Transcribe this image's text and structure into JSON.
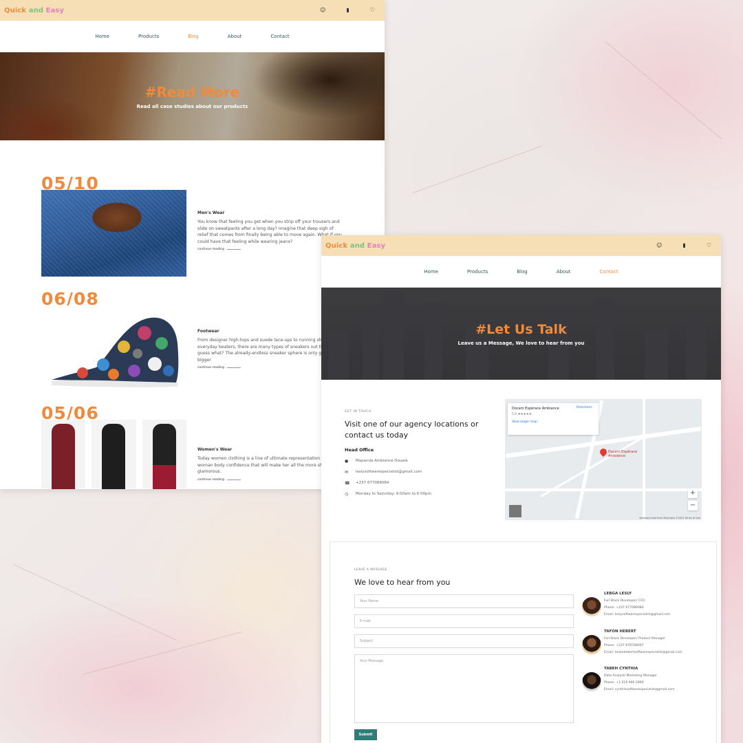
{
  "colors": {
    "accent_orange": "#f08a3c",
    "nav_teal": "#2f5a55",
    "topbar_cream": "#f6dfb4",
    "submit_green": "#2e7d78"
  },
  "blog_page": {
    "logo": {
      "part1": "Quick",
      "part2": " and ",
      "part3": "Easy"
    },
    "top_icons": [
      "user-icon",
      "bag-icon",
      "heart-icon"
    ],
    "nav": [
      {
        "label": "Home"
      },
      {
        "label": "Products"
      },
      {
        "label": "Blog"
      },
      {
        "label": "About"
      },
      {
        "label": "Contact"
      }
    ],
    "active_nav": "Blog",
    "hero": {
      "title": "#Read More",
      "subtitle": "Read all case studies about our products"
    },
    "posts": [
      {
        "date": "05/10",
        "category": "Men's Wear",
        "body": "You know that feeling you get when you strip off your trousers and slide on sweatpants after a long day? Imagine that deep sigh of relief that comes from finally being able to move again. What if you could have that feeling while wearing jeans?",
        "link": "continue reading"
      },
      {
        "date": "06/08",
        "category": "Footwear",
        "body": "From designer high-tops and suede lace-ups to running shoes and everyday beaters, there are many types of sneakers out there. And guess what? The already-endless sneaker sphere is only getting bigger",
        "link": "continue reading"
      },
      {
        "date": "05/06",
        "category": "Women's Wear",
        "body": "Today women clothing is a line of ultimate representation of woman body confidence that will make her all the more stylish and glamorous.",
        "link": "continue reading"
      }
    ]
  },
  "contact_page": {
    "logo": {
      "part1": "Quick",
      "part2": " and ",
      "part3": "Easy"
    },
    "top_icons": [
      "user-icon",
      "bag-icon",
      "heart-icon"
    ],
    "nav": [
      {
        "label": "Home"
      },
      {
        "label": "Products"
      },
      {
        "label": "Blog"
      },
      {
        "label": "About"
      },
      {
        "label": "Contact"
      }
    ],
    "active_nav": "Contact",
    "hero": {
      "title": "#Let Us Talk",
      "subtitle": "Leave us a Message, We love to hear from you"
    },
    "get_in_touch": "GET IN TOUCH",
    "heading": "Visit one of our agency locations or contact us today",
    "head_office": "Head Office",
    "info": [
      {
        "icon": "location-icon",
        "text": "Mapanda Ambiance Douala"
      },
      {
        "icon": "mail-icon",
        "text": "leslysoftwarespecialist@gmail.com"
      },
      {
        "icon": "phone-icon",
        "text": "+237 677089084"
      },
      {
        "icon": "clock-icon",
        "text": "Monday to Saturday: 9.00am to 6.00pm"
      }
    ],
    "map": {
      "card_title": "Docam Espérace Ambiance",
      "card_sub": "5.0 ★★★★★",
      "card_link": "View larger map",
      "directions": "Directions",
      "pin_label": "Docam Espérace Ambiance",
      "zoom_in": "+",
      "zoom_out": "−",
      "attribution": "Keyboard shortcuts  Map data ©2022  Terms of Use"
    },
    "form": {
      "leave_message": "LEAVE A MESSAGE",
      "title": "We love to hear from you",
      "name_placeholder": "Your Name",
      "email_placeholder": "E-mail",
      "subject_placeholder": "Subject",
      "message_placeholder": "Your Message",
      "submit": "Submit"
    },
    "team": [
      {
        "name": "LEBGA LESLY",
        "role": "Full Stack Developer/ CFO",
        "phone": "Phone: +237 677089084",
        "email": "Email: leslysoftwarespecialist@gmail.com"
      },
      {
        "name": "TAFON HEBERT",
        "role": "Full Stack Developer/ Product Manager",
        "phone": "Phone: +237 678748097",
        "email": "Email: tonkehebertsoftwarespecialist@gmail.com"
      },
      {
        "name": "TABEH CYNTHIA",
        "role": "Data Analyst/ Marketing Manager",
        "phone": "Phone: +1 619 966 2890",
        "email": "Email: cynthiasoftwarespecialist@gmail.com"
      }
    ]
  }
}
